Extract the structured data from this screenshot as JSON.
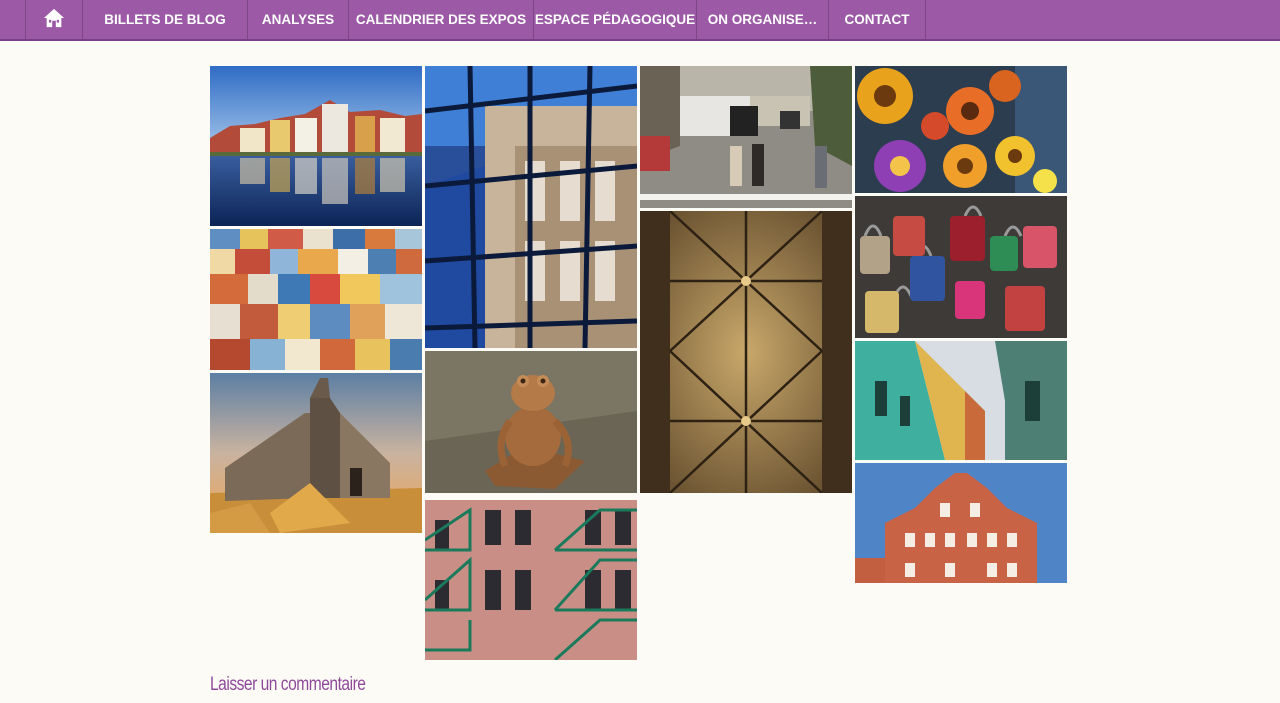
{
  "nav": {
    "home_icon": "home-icon",
    "items": [
      {
        "label": "BILLETS DE BLOG"
      },
      {
        "label": "ANALYSES"
      },
      {
        "label": "CALENDRIER DES EXPOS"
      },
      {
        "label": "ESPACE PÉDAGOGIQUE"
      },
      {
        "label": "ON ORGANISE…"
      },
      {
        "label": "CONTACT"
      }
    ]
  },
  "colors": {
    "nav_bg": "#9b59a6",
    "accent": "#8e4a99",
    "page_bg": "#fdfbf6"
  },
  "gallery": {
    "photos": [
      {
        "subject": "lakeside town reflection"
      },
      {
        "subject": "colorful hillside houses"
      },
      {
        "subject": "stone church at sunset"
      },
      {
        "subject": "glass facade reflecting building"
      },
      {
        "subject": "frog statue"
      },
      {
        "subject": "brick building with green fire escapes"
      },
      {
        "subject": "city street crossing"
      },
      {
        "subject": "gothic vaulted ceiling"
      },
      {
        "subject": "strawflowers"
      },
      {
        "subject": "love padlocks"
      },
      {
        "subject": "colorful colonial street"
      },
      {
        "subject": "ornate red gabled facade"
      }
    ]
  },
  "comment": {
    "label": "Laisser un commentaire"
  }
}
